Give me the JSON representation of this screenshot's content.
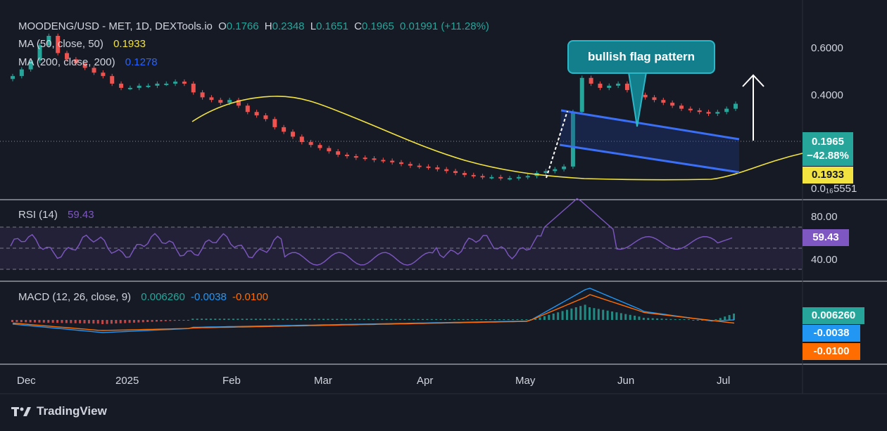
{
  "header": {
    "symbol": "MOODENG/USD - MET, 1D, DEXTools.io",
    "o_label": "O",
    "o_value": "0.1766",
    "h_label": "H",
    "h_value": "0.2348",
    "l_label": "L",
    "l_value": "0.1651",
    "c_label": "C",
    "c_value": "0.1965",
    "change": "0.01991 (+11.28%)"
  },
  "ma50": {
    "label": "MA (50, close, 50)",
    "value": "0.1933"
  },
  "ma200": {
    "label": "MA (200, close, 200)",
    "value": "0.1278"
  },
  "rsi": {
    "label": "RSI (14)",
    "value": "59.43"
  },
  "macd": {
    "label": "MACD (12, 26, close, 9)",
    "macd": "0.006260",
    "signal": "-0.0038",
    "hist": "-0.0100"
  },
  "annotation": {
    "text": "bullish flag pattern"
  },
  "price_tags": {
    "last": "0.1965",
    "pct": "−42.88%",
    "ma50": "0.1933"
  },
  "branding": {
    "name": "TradingView"
  },
  "colors": {
    "bg": "#161a25",
    "up": "#26a69a",
    "down": "#ef5350",
    "ma50": "#f2e340",
    "ma200": "#2962ff",
    "rsi": "#7e57c2",
    "macd": "#2196f3",
    "signal": "#ff6d00",
    "channel": "#2962ff",
    "callout": "#137f8c"
  },
  "chart_data": [
    {
      "type": "candlestick",
      "title": "MOODENG/USD - MET, 1D, DEXTools.io",
      "x_ticks": [
        "Dec",
        "2025",
        "Feb",
        "Mar",
        "Apr",
        "May",
        "Jun",
        "Jul"
      ],
      "y_ticks": [
        "0.6000",
        "0.4000",
        "0.0₁₆5551"
      ],
      "y_scale": "log",
      "last": {
        "open": 0.1766,
        "high": 0.2348,
        "low": 0.1651,
        "close": 0.1965,
        "change": 0.01991,
        "change_pct": 11.28
      },
      "ma50_last": 0.1933,
      "ma200_last": 0.1278,
      "approx_closes": [
        0.32,
        0.36,
        0.42,
        0.55,
        0.65,
        0.48,
        0.43,
        0.4,
        0.37,
        0.34,
        0.32,
        0.28,
        0.26,
        0.26,
        0.27,
        0.27,
        0.28,
        0.28,
        0.29,
        0.28,
        0.24,
        0.22,
        0.21,
        0.2,
        0.21,
        0.19,
        0.17,
        0.16,
        0.15,
        0.13,
        0.12,
        0.11,
        0.1,
        0.095,
        0.09,
        0.085,
        0.08,
        0.078,
        0.076,
        0.075,
        0.073,
        0.072,
        0.07,
        0.068,
        0.066,
        0.065,
        0.064,
        0.062,
        0.06,
        0.058,
        0.056,
        0.055,
        0.054,
        0.054,
        0.053,
        0.053,
        0.054,
        0.055,
        0.058,
        0.06,
        0.062,
        0.065,
        0.17,
        0.31,
        0.28,
        0.26,
        0.27,
        0.28,
        0.25,
        0.23,
        0.22,
        0.21,
        0.2,
        0.19,
        0.18,
        0.175,
        0.17,
        0.165,
        0.17,
        0.18,
        0.1965
      ],
      "annotations": [
        "bullish flag pattern"
      ]
    },
    {
      "type": "line",
      "title": "RSI (14)",
      "y_ticks": [
        "80.00",
        "40.00"
      ],
      "last": 59.43,
      "bands": [
        70,
        50,
        30
      ]
    },
    {
      "type": "bar",
      "title": "MACD (12, 26, close, 9)",
      "last": {
        "macd": 0.00626,
        "signal": -0.0038,
        "histogram": -0.01
      }
    }
  ]
}
